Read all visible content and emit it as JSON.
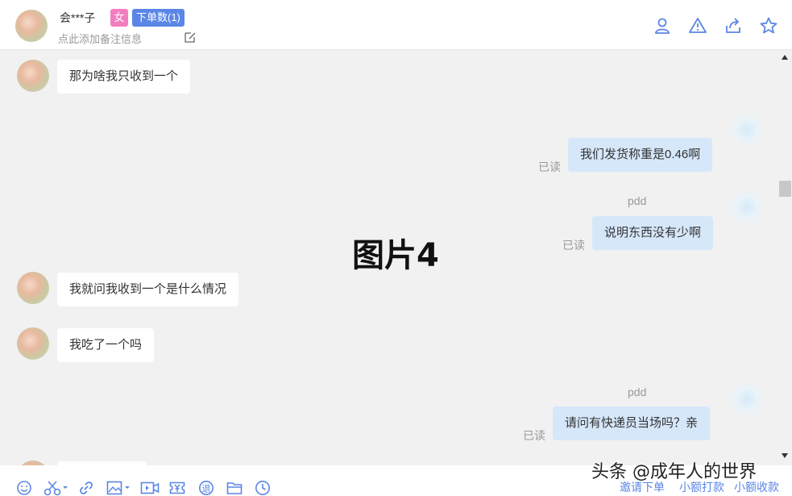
{
  "header": {
    "contact_name": "会***子",
    "gender_tag": "女",
    "order_count_tag": "下单数(1)",
    "note_placeholder": "点此添加备注信息"
  },
  "header_actions": [
    {
      "icon": "user-profile-icon"
    },
    {
      "icon": "warning-icon"
    },
    {
      "icon": "share-icon"
    },
    {
      "icon": "star-icon"
    }
  ],
  "messages": [
    {
      "direction": "in",
      "text": "那为啥我只收到一个"
    },
    {
      "direction": "out",
      "sender": "",
      "text": "我们发货称重是0.46啊",
      "status": "已读"
    },
    {
      "direction": "out",
      "sender": "pdd",
      "text": "说明东西没有少啊",
      "status": "已读"
    },
    {
      "direction": "in",
      "text": "我就问我收到一个是什么情况"
    },
    {
      "direction": "in",
      "text": "我吃了一个吗"
    },
    {
      "direction": "out",
      "sender": "pdd",
      "text": "请问有快递员当场吗？亲",
      "status": "已读"
    }
  ],
  "overlay_label": "图片4",
  "toolbar_icons": [
    "emoji-icon",
    "scissors-icon",
    "link-icon",
    "image-icon",
    "video-icon",
    "coupon-icon",
    "refund-icon",
    "folder-icon",
    "clock-icon"
  ],
  "toolbar_links": {
    "invite_order": "邀请下单",
    "small_payment": "小额打款",
    "small_collect": "小额收款"
  },
  "watermark": "头条 @成年人的世界",
  "colors": {
    "accent": "#5b86e6",
    "gender_tag": "#f27ec0",
    "outgoing_bubble": "#d6e7fa",
    "incoming_bubble": "#ffffff"
  }
}
